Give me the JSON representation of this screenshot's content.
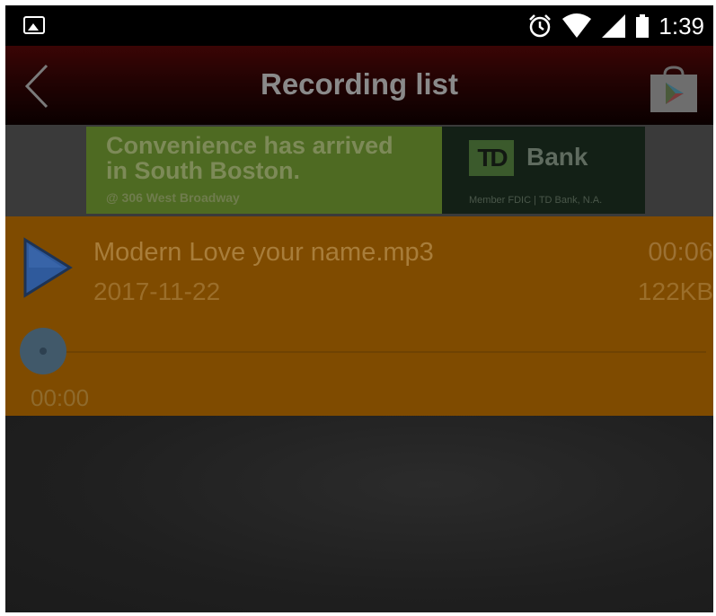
{
  "status_bar": {
    "time": "1:39",
    "icons": [
      "image-icon",
      "alarm-icon",
      "wifi-icon",
      "cell-signal-icon",
      "battery-icon"
    ]
  },
  "title_bar": {
    "title": "Recording list",
    "left_icon": "back-icon",
    "right_icon": "play-store-icon"
  },
  "ad": {
    "line1": "Convenience has arrived",
    "line2": "in South Boston.",
    "line3": "@ 306 West Broadway",
    "logo_text": "TD",
    "brand": "Bank",
    "fine_print": "Member FDIC | TD Bank, N.A."
  },
  "recording": {
    "file_name": "Modern Love your name.mp3",
    "date": "2017-11-22",
    "duration": "00:06",
    "size": "122KB",
    "position": "00:00",
    "progress_fraction": 0
  },
  "colors": {
    "accent": "#7f4b00",
    "title_bar": "#220303",
    "background": "#202020",
    "play_icon": "#2f5a9c"
  }
}
